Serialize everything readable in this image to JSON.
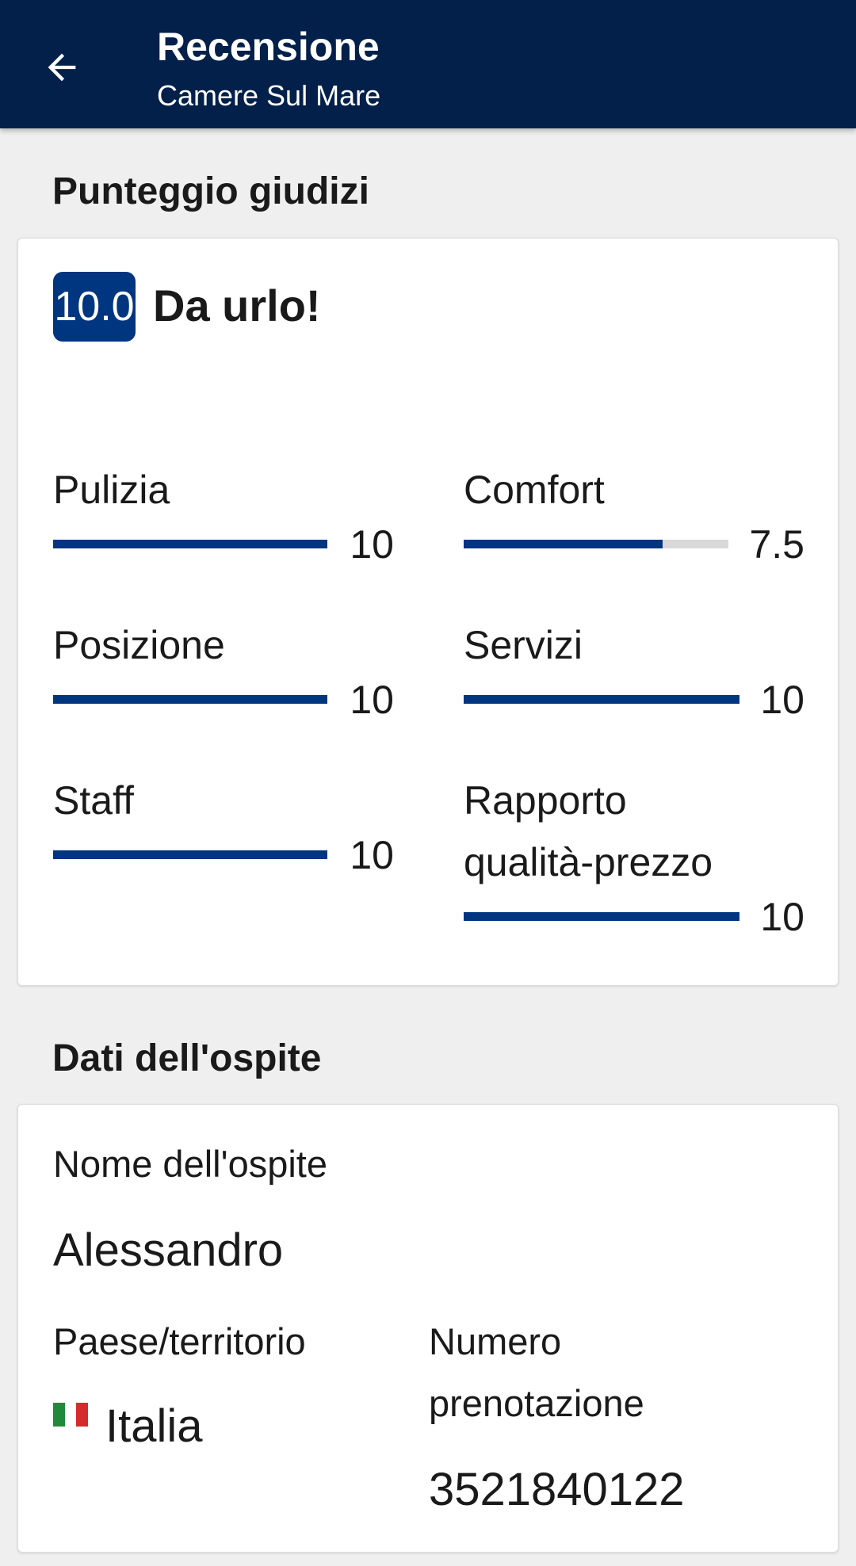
{
  "header": {
    "title": "Recensione",
    "subtitle": "Camere Sul Mare"
  },
  "scores": {
    "heading": "Punteggio giudizi",
    "overall_score": "10.0",
    "overall_label": "Da urlo!",
    "accent_color": "#003580",
    "categories": [
      {
        "label": "Pulizia",
        "value": "10",
        "fraction": 1.0
      },
      {
        "label": "Comfort",
        "value": "7.5",
        "fraction": 0.75
      },
      {
        "label": "Posizione",
        "value": "10",
        "fraction": 1.0
      },
      {
        "label": "Servizi",
        "value": "10",
        "fraction": 1.0
      },
      {
        "label": "Staff",
        "value": "10",
        "fraction": 1.0
      },
      {
        "label": "Rapporto qualità-prezzo",
        "value": "10",
        "fraction": 1.0
      }
    ]
  },
  "guest": {
    "heading": "Dati dell'ospite",
    "name_label": "Nome dell'ospite",
    "name": "Alessandro",
    "country_label": "Paese/territorio",
    "country": "Italia",
    "country_flag_icon": "italy-flag-icon",
    "booking_label": "Numero prenotazione",
    "booking_number": "3521840122"
  },
  "icons": {
    "back": "arrow-left-icon"
  }
}
